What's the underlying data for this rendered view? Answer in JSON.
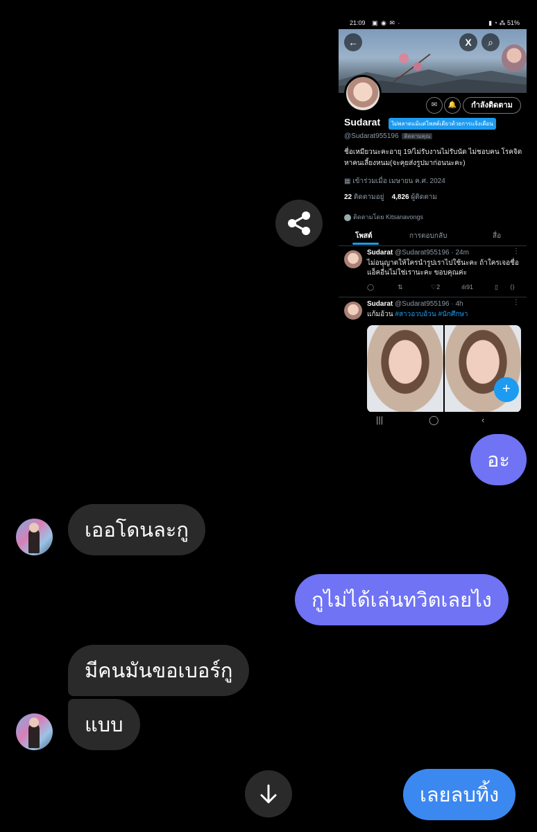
{
  "screenshot": {
    "status_bar": {
      "time": "21:09",
      "battery": "51%"
    },
    "profile": {
      "follow_button": "กำลังติดตาม",
      "name": "Sudarat",
      "notify_tooltip": "ไม่พลาดแม้แต่โพสต์เดียวด้วยการแจ้งเตือน",
      "handle": "@Sudarat955196",
      "follows_you": "ติดตามคุณ",
      "bio": "ชื่อเหมียวนะคะอายุ 19/ไม่รับงานไม่รับนัด ไม่ชอบคน โรคจิต หาคนเลี้ยงหนม(จะคุยส่งรูปมาก่อนนะคะ)",
      "joined": "เข้าร่วมเมื่อ เมษายน ค.ศ. 2024",
      "following_count": "22",
      "following_label": "ติดตามอยู่",
      "followers_count": "4,826",
      "followers_label": "ผู้ติดตาม",
      "followed_by": "ติดตามโดย Kitsanavongs"
    },
    "tabs": [
      "โพสต์",
      "การตอบกลับ",
      "สื่อ"
    ],
    "tweets": [
      {
        "name": "Sudarat",
        "handle": "@Sudarat955196",
        "time": "· 24m",
        "text": "ไม่อนุญาตให้ใครนำรูปเราไปใช้นะคะ ถ้าใครเจอชื่อแอ็คอื่นไม่ใช่เรานะคะ ขอบคุณค่ะ",
        "likes": "2",
        "views": "91"
      },
      {
        "name": "Sudarat",
        "handle": "@Sudarat955196",
        "time": "· 4h",
        "text": "แก้มอ้วน",
        "hashtags": "#สาวอวบอ้วน #นักศึกษา"
      }
    ]
  },
  "messages": [
    {
      "side": "out",
      "text": "อะ"
    },
    {
      "side": "in",
      "text": "เออโดนละกู"
    },
    {
      "side": "out",
      "text": "กูไม่ได้เล่นทวิตเลยไง"
    },
    {
      "side": "in",
      "text": "มีคนมันขอเบอร์กู"
    },
    {
      "side": "in",
      "text": "แบบ"
    },
    {
      "side": "out",
      "text": "เลยลบทิ้ง"
    }
  ],
  "icons": {
    "share": "share-icon",
    "scroll_down": "arrow-down-icon"
  },
  "colors": {
    "outgoing_bubble": "#6f73f4",
    "outgoing_bubble_last": "#3b88f1",
    "incoming_bubble": "#2a2a2a",
    "twitter_blue": "#1d9bf0"
  }
}
